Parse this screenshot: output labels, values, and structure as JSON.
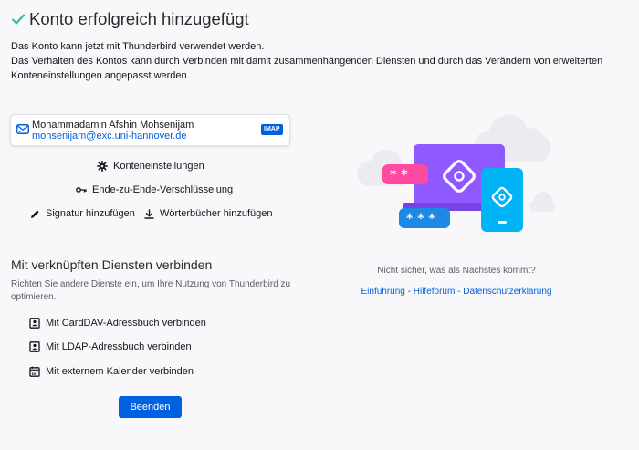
{
  "header": {
    "title": "Konto erfolgreich hinzugefügt",
    "description_line1": "Das Konto kann jetzt mit Thunderbird verwendet werden.",
    "description_line2": "Das Verhalten des Kontos kann durch Verbinden mit damit zusammenhängenden Diensten und durch das Verändern von erweiterten",
    "description_line3": "Konteneinstellungen angepasst werden."
  },
  "account": {
    "name": "Mohammadamin Afshin Mohsenijam",
    "email": "mohsenijam@exc.uni-hannover.de",
    "protocol": "IMAP",
    "icon": "mail-account-icon"
  },
  "actions": {
    "account_settings": "Konteneinstellungen",
    "e2e_encryption": "Ende-zu-Ende-Verschlüsselung",
    "add_signature": "Signatur hinzufügen",
    "add_dictionaries": "Wörterbücher hinzufügen"
  },
  "connect": {
    "heading": "Mit verknüpften Diensten verbinden",
    "description": "Richten Sie andere Dienste ein, um Ihre Nutzung von Thunderbird zu optimieren.",
    "carddav": "Mit CardDAV-Adressbuch verbinden",
    "ldap": "Mit LDAP-Adressbuch verbinden",
    "calendar": "Mit externem Kalender verbinden"
  },
  "finish_button": "Beenden",
  "help": {
    "question": "Nicht sicher, was als Nächstes kommt?",
    "intro": "Einführung",
    "forum": "Hilfeforum",
    "privacy": "Datenschutzerklärung",
    "separator": " - "
  },
  "colors": {
    "accent": "#0061e0",
    "success": "#2ac3a2",
    "illustration_purple": "#9059ff",
    "illustration_cyan": "#00b3f4",
    "illustration_pink": "#ff4aa2"
  }
}
